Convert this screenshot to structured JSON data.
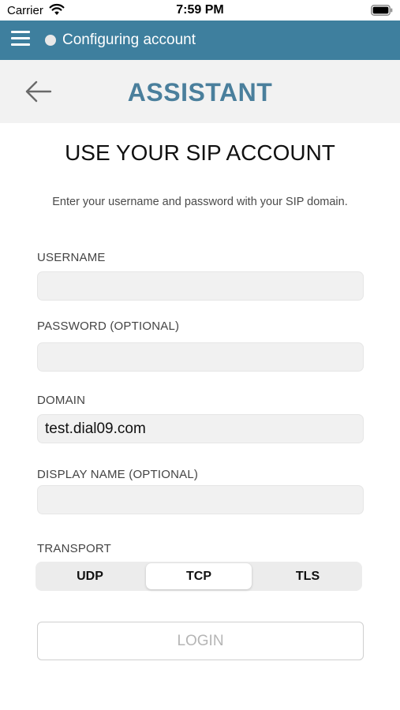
{
  "status_bar": {
    "carrier": "Carrier",
    "time": "7:59 PM"
  },
  "app_bar": {
    "title": "Configuring account",
    "color": "#3e7f9e"
  },
  "header": {
    "title": "ASSISTANT",
    "title_color": "#4a7f9c"
  },
  "form": {
    "heading": "USE YOUR SIP ACCOUNT",
    "subtitle": "Enter your username and password with your SIP domain.",
    "username": {
      "label": "USERNAME",
      "value": ""
    },
    "password": {
      "label": "PASSWORD (OPTIONAL)",
      "value": ""
    },
    "domain": {
      "label": "DOMAIN",
      "value": "test.dial09.com"
    },
    "display_name": {
      "label": "DISPLAY NAME (OPTIONAL)",
      "value": ""
    },
    "transport": {
      "label": "TRANSPORT",
      "options": [
        "UDP",
        "TCP",
        "TLS"
      ],
      "selected": "TCP"
    },
    "login_label": "LOGIN"
  },
  "icons": {
    "menu": "hamburger-menu-icon",
    "back": "back-arrow-icon",
    "wifi": "wifi-icon",
    "battery": "battery-icon",
    "presence": "presence-dot-icon"
  }
}
